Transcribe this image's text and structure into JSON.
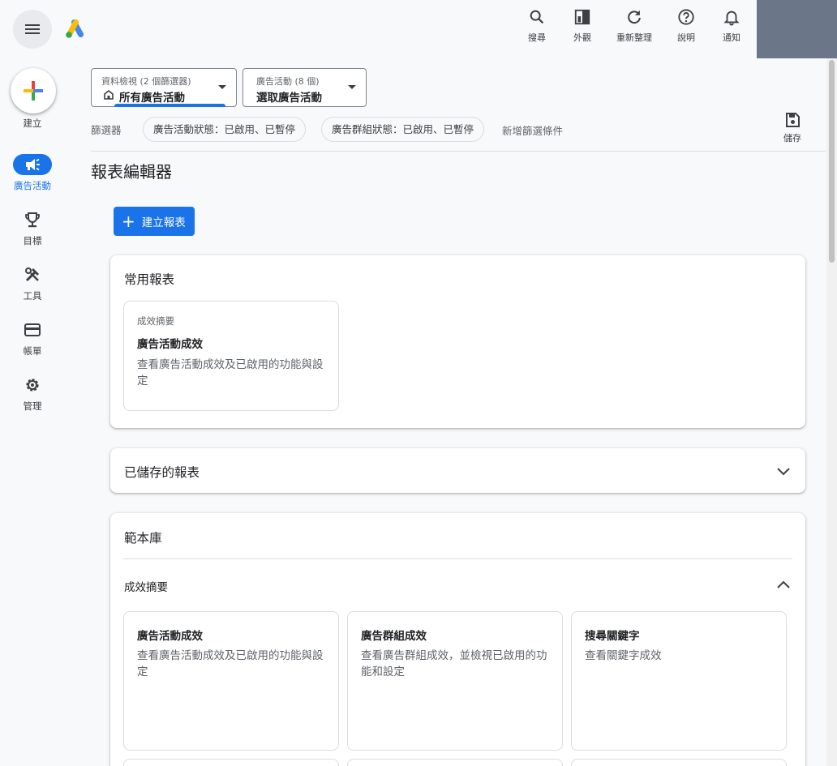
{
  "topbar": {
    "actions": [
      {
        "icon": "search-icon",
        "label": "搜尋"
      },
      {
        "icon": "appearance-icon",
        "label": "外觀"
      },
      {
        "icon": "refresh-icon",
        "label": "重新整理"
      },
      {
        "icon": "help-icon",
        "label": "說明"
      },
      {
        "icon": "bell-icon",
        "label": "通知"
      }
    ]
  },
  "rail": {
    "create_label": "建立",
    "items": [
      {
        "icon": "megaphone-icon",
        "label": "廣告活動",
        "active": true
      },
      {
        "icon": "trophy-icon",
        "label": "目標"
      },
      {
        "icon": "tools-icon",
        "label": "工具"
      },
      {
        "icon": "credit-card-icon",
        "label": "帳單"
      },
      {
        "icon": "gear-icon",
        "label": "管理"
      }
    ]
  },
  "selectors": {
    "view": {
      "small": "資料檢視 (2 個篩選器)",
      "value": "所有廣告活動"
    },
    "campaign": {
      "small": "廣告活動 (8 個)",
      "value": "選取廣告活動"
    }
  },
  "filters": {
    "label": "篩選器",
    "chips": [
      "廣告活動狀態：已啟用、已暫停",
      "廣告群組狀態：已啟用、已暫停"
    ],
    "add": "新增篩選條件",
    "save_label": "儲存"
  },
  "page": {
    "title": "報表編輯器",
    "create_report": "建立報表"
  },
  "common_reports": {
    "title": "常用報表",
    "tile": {
      "kicker": "成效摘要",
      "name": "廣告活動成效",
      "desc": "查看廣告活動成效及已啟用的功能與設定"
    }
  },
  "saved_reports": {
    "title": "已儲存的報表"
  },
  "template_library": {
    "title": "範本庫",
    "section": "成效摘要",
    "tiles": [
      {
        "name": "廣告活動成效",
        "desc": "查看廣告活動成效及已啟用的功能與設定"
      },
      {
        "name": "廣告群組成效",
        "desc": "查看廣告群組成效，並檢視已啟用的功能和設定"
      },
      {
        "name": "搜尋關鍵字",
        "desc": "查看關鍵字成效"
      }
    ]
  },
  "colors": {
    "accent": "#1a73e8",
    "avatar_block": "#6b7689"
  }
}
